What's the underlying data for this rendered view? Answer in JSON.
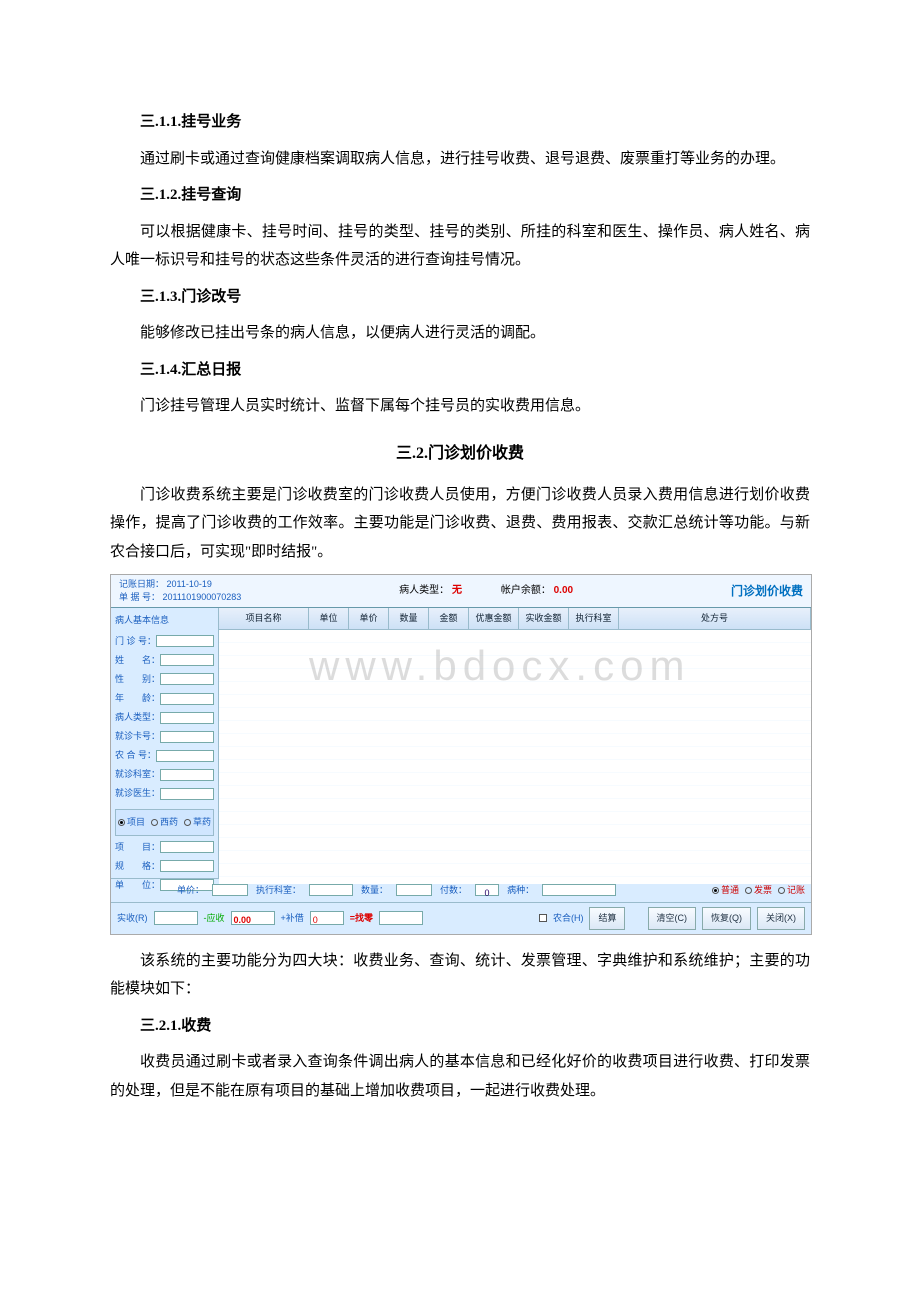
{
  "sections": {
    "s311": {
      "heading": "三.1.1.挂号业务",
      "body": "通过刷卡或通过查询健康档案调取病人信息，进行挂号收费、退号退费、废票重打等业务的办理。"
    },
    "s312": {
      "heading": "三.1.2.挂号查询",
      "body": "可以根据健康卡、挂号时间、挂号的类型、挂号的类别、所挂的科室和医生、操作员、病人姓名、病人唯一标识号和挂号的状态这些条件灵活的进行查询挂号情况。"
    },
    "s313": {
      "heading": "三.1.3.门诊改号",
      "body": "能够修改已挂出号条的病人信息，以便病人进行灵活的调配。"
    },
    "s314": {
      "heading": "三.1.4.汇总日报",
      "body": "门诊挂号管理人员实时统计、监督下属每个挂号员的实收费用信息。"
    },
    "s32": {
      "heading": "三.2.门诊划价收费",
      "body": "门诊收费系统主要是门诊收费室的门诊收费人员使用，方便门诊收费人员录入费用信息进行划价收费操作，提高了门诊收费的工作效率。主要功能是门诊收费、退费、费用报表、交款汇总统计等功能。与新农合接口后，可实现\"即时结报\"。"
    },
    "after_shot": "该系统的主要功能分为四大块：收费业务、查询、统计、发票管理、字典维护和系统维护；主要的功能模块如下：",
    "s321": {
      "heading": "三.2.1.收费",
      "body": "收费员通过刷卡或者录入查询条件调出病人的基本信息和已经化好价的收费项目进行收费、打印发票的处理，但是不能在原有项目的基础上增加收费项目，一起进行收费处理。"
    }
  },
  "screenshot": {
    "header": {
      "rec_date_label": "记账日期：",
      "rec_date_value": "2011-10-19",
      "bill_no_label": "单 据 号：",
      "bill_no_value": "2011101900070283",
      "patient_type_label": "病人类型：",
      "patient_type_value": "无",
      "balance_label": "帐户余额：",
      "balance_value": "0.00",
      "title": "门诊划价收费"
    },
    "sidebar": {
      "panel_title": "病人基本信息",
      "fields": {
        "f1": "门 诊 号：",
        "f2": "姓　　名：",
        "f3": "性　　别：",
        "f4": "年　　龄：",
        "f5": "病人类型：",
        "f6": "就诊卡号：",
        "f7": "农 合 号：",
        "f8": "就诊科室：",
        "f9": "就诊医生："
      },
      "radios": {
        "r1": "项目",
        "r2": "西药",
        "r3": "草药"
      },
      "lower": {
        "l1": "项　　目：",
        "l2": "规　　格：",
        "l3": "单　　位："
      }
    },
    "table_headers": [
      "项目名称",
      "单位",
      "单价",
      "数量",
      "金额",
      "优惠金额",
      "实收金额",
      "执行科室",
      "处方号"
    ],
    "watermark": "www.bdocx.com",
    "midbar": {
      "lbl_price": "单价：",
      "lbl_dept": "执行科室：",
      "lbl_qty": "数量：",
      "lbl_dose": "付数：",
      "val_dose": "0",
      "lbl_kind": "病种：",
      "radios": {
        "r1": "普通",
        "r2": "发票",
        "r3": "记账"
      }
    },
    "bottombar": {
      "lbl_real": "实收(R)",
      "lbl_should": "-应收",
      "val_should": "0.00",
      "lbl_add": "+补借",
      "val_add": "0",
      "lbl_change": "=找零",
      "chk_label": "农合(H)",
      "btn_settle": "结算",
      "btn_clear": "清空(C)",
      "btn_restore": "恢复(Q)",
      "btn_close": "关闭(X)"
    }
  }
}
